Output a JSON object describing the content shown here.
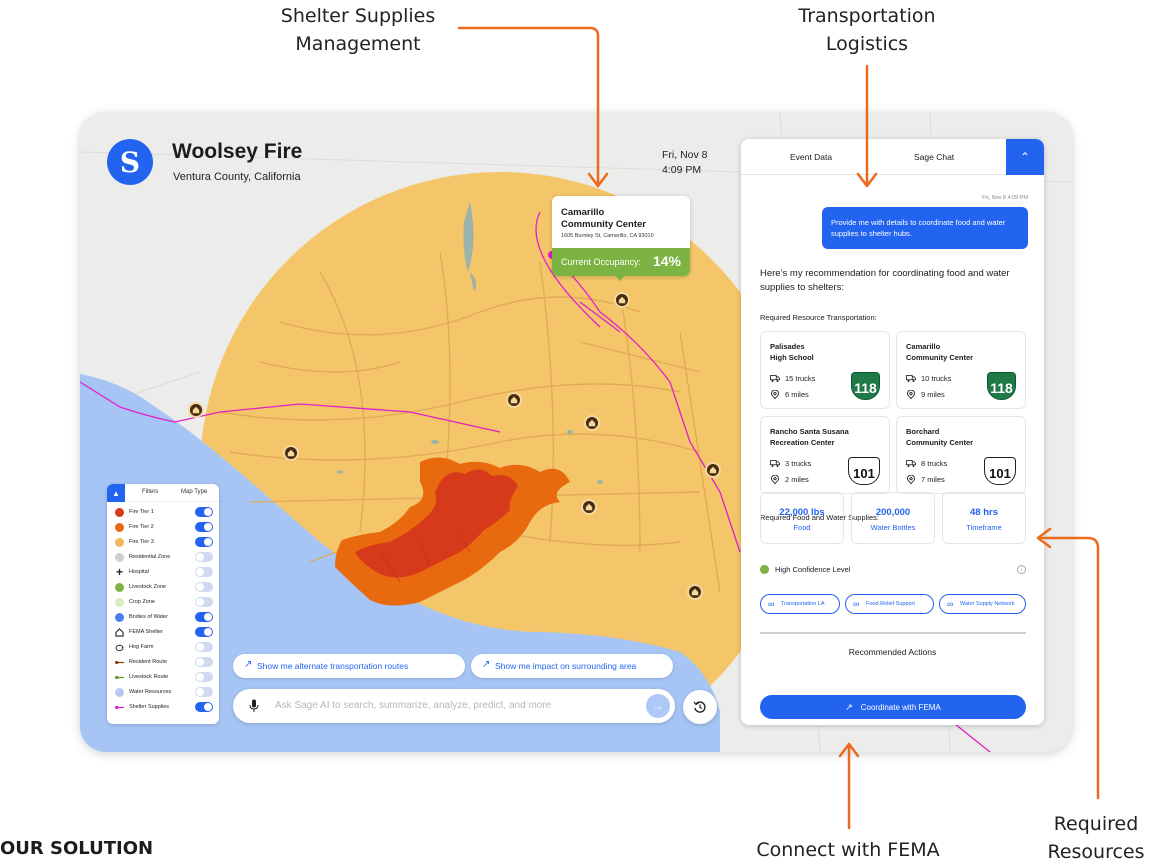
{
  "annotations": {
    "shelter_supplies": "Shelter Supplies\nManagement",
    "transportation": "Transportation\nLogistics",
    "connect_fema": "Connect with FEMA",
    "required_resources": "Required\nResources",
    "our_solution": "OUR SOLUTION"
  },
  "header": {
    "logo_glyph": "S",
    "title": "Woolsey Fire",
    "location": "Ventura County, California",
    "date": "Fri, Nov 8",
    "time": "4:09 PM"
  },
  "shelter_popup": {
    "name_line1": "Camarillo",
    "name_line2": "Community Center",
    "address": "1605 Burnley St, Camarillo, CA 93010",
    "occupancy_label": "Current Occupancy:",
    "occupancy_value": "14%",
    "occupancy_fraction": 0.14
  },
  "filters": {
    "tabs": [
      "Filters",
      "Map Type"
    ],
    "collapse_icon": "chevron-up-icon",
    "items": [
      {
        "label": "Fire Tier 1",
        "icon": "dot",
        "color": "#d63a1a",
        "on": true
      },
      {
        "label": "Fire Tier 2",
        "icon": "dot",
        "color": "#e8690e",
        "on": true
      },
      {
        "label": "Fire Tier 3",
        "icon": "dot",
        "color": "#f4b65c",
        "on": true
      },
      {
        "label": "Residential Zone",
        "icon": "dot",
        "color": "#cfcfcf",
        "on": false
      },
      {
        "label": "Hospital",
        "icon": "plus",
        "color": "#111111",
        "on": false
      },
      {
        "label": "Livestock Zone",
        "icon": "dot",
        "color": "#7cb342",
        "on": false
      },
      {
        "label": "Crop Zone",
        "icon": "dot",
        "color": "#d7ecc0",
        "on": false
      },
      {
        "label": "Bodies of Water",
        "icon": "dot",
        "color": "#4c7df0",
        "on": true
      },
      {
        "label": "FEMA Shelter",
        "icon": "house",
        "color": "#222222",
        "on": true
      },
      {
        "label": "Hog Farm",
        "icon": "pig",
        "color": "#222222",
        "on": false
      },
      {
        "label": "Resident Route",
        "icon": "route",
        "color": "#8a3a12",
        "on": false
      },
      {
        "label": "Livestock Route",
        "icon": "route",
        "color": "#5c9a2c",
        "on": false
      },
      {
        "label": "Water Resources",
        "icon": "dot",
        "color": "#b8c8f0",
        "on": false
      },
      {
        "label": "Shelter Supplies",
        "icon": "route",
        "color": "#e020c8",
        "on": true
      }
    ]
  },
  "suggestions": [
    "Show me alternate transportation routes",
    "Show me impact on surrounding area"
  ],
  "search": {
    "placeholder": "Ask Sage AI to search, summarize, analyze, predict, and more"
  },
  "panel": {
    "tabs": [
      "Event Data",
      "Sage Chat"
    ],
    "timestamp": "Fri, Nov 8  4:09 PM",
    "user_message": "Provide me with details to coordinate food and water supplies to shelter hubs.",
    "reply_intro": "Here’s my recommendation for coordinating food and water supplies to shelters:",
    "transport_title": "Required Resource Transportation:",
    "transport_cards": [
      {
        "name_line1": "Palisades",
        "name_line2": "High School",
        "trucks": "15 trucks",
        "distance": "6 miles",
        "route": "118",
        "route_type": "ca"
      },
      {
        "name_line1": "Camarillo",
        "name_line2": "Community Center",
        "trucks": "10 trucks",
        "distance": "9 miles",
        "route": "118",
        "route_type": "ca"
      },
      {
        "name_line1": "Rancho Santa Susana",
        "name_line2": "Recreation Center",
        "trucks": "3 trucks",
        "distance": "2 miles",
        "route": "101",
        "route_type": "us"
      },
      {
        "name_line1": "Borchard",
        "name_line2": "Community Center",
        "trucks": "8 trucks",
        "distance": "7 miles",
        "route": "101",
        "route_type": "us"
      }
    ],
    "supplies_title": "Required Food and Water Supplies:",
    "supplies": [
      {
        "value": "22,000 lbs",
        "label": "Food"
      },
      {
        "value": "200,000",
        "label": "Water Bottles"
      },
      {
        "value": "48 hrs",
        "label": "Timeframe"
      }
    ],
    "confidence": "High Confidence Level",
    "links": [
      "Transportation LA",
      "Food Relief Support",
      "Water Supply Network"
    ],
    "actions_title": "Recommended Actions",
    "action_button": "Coordinate with FEMA"
  }
}
